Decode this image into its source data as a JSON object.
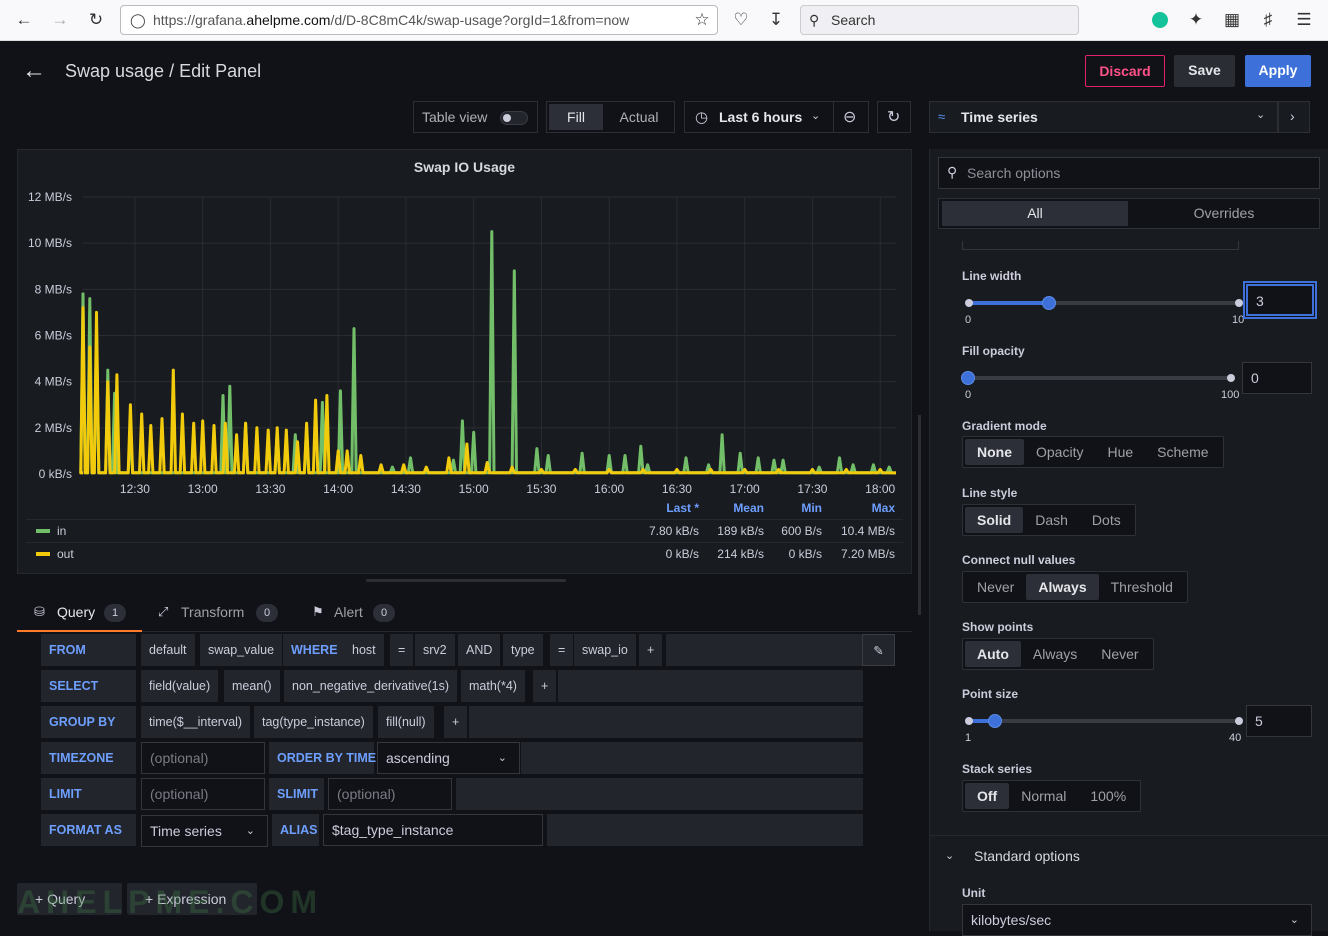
{
  "browser": {
    "url_pre": "https://grafana.",
    "url_domain": "ahelpme.com",
    "url_post": "/d/D-8C8mC4k/swap-usage?orgId=1&from=now",
    "search_placeholder": "Search"
  },
  "header": {
    "title": "Swap usage / Edit Panel",
    "discard": "Discard",
    "save": "Save",
    "apply": "Apply"
  },
  "toolbar": {
    "table_view": "Table view",
    "fill": "Fill",
    "actual": "Actual",
    "time_range": "Last 6 hours",
    "viz": "Time series"
  },
  "chart_data": {
    "type": "line",
    "title": "Swap IO Usage",
    "y_ticks": [
      "12 MB/s",
      "10 MB/s",
      "8 MB/s",
      "6 MB/s",
      "4 MB/s",
      "2 MB/s",
      "0 kB/s"
    ],
    "ylim": [
      0,
      12
    ],
    "yunit": "MB/s",
    "x_ticks": [
      "12:30",
      "13:00",
      "13:30",
      "14:00",
      "14:30",
      "15:00",
      "15:30",
      "16:00",
      "16:30",
      "17:00",
      "17:30",
      "18:00"
    ],
    "xlim": [
      "12:07",
      "18:07"
    ],
    "colors": {
      "in": "#73bf69",
      "out": "#f2cc0c"
    },
    "series": [
      {
        "name": "in",
        "peaks": [
          [
            "12:07",
            7.8
          ],
          [
            "12:10",
            7.6
          ],
          [
            "12:13",
            6.0
          ],
          [
            "12:18",
            4.5
          ],
          [
            "12:21",
            3.5
          ],
          [
            "12:28",
            2.0
          ],
          [
            "13:09",
            3.4
          ],
          [
            "13:12",
            3.8
          ],
          [
            "13:19",
            2.2
          ],
          [
            "13:33",
            1.8
          ],
          [
            "13:41",
            1.7
          ],
          [
            "13:46",
            2.0
          ],
          [
            "13:53",
            3.1
          ],
          [
            "14:01",
            3.6
          ],
          [
            "14:07",
            6.3
          ],
          [
            "14:24",
            0.3
          ],
          [
            "14:32",
            0.7
          ],
          [
            "14:51",
            0.6
          ],
          [
            "14:55",
            2.3
          ],
          [
            "15:00",
            1.8
          ],
          [
            "15:08",
            10.5
          ],
          [
            "15:18",
            8.8
          ],
          [
            "15:28",
            1.1
          ],
          [
            "15:33",
            0.8
          ],
          [
            "15:48",
            0.9
          ],
          [
            "16:00",
            0.8
          ],
          [
            "16:07",
            0.8
          ],
          [
            "16:14",
            1.2
          ],
          [
            "16:17",
            0.4
          ],
          [
            "16:34",
            0.7
          ],
          [
            "16:44",
            0.4
          ],
          [
            "16:50",
            1.7
          ],
          [
            "16:58",
            0.9
          ],
          [
            "17:06",
            0.7
          ],
          [
            "17:13",
            0.6
          ],
          [
            "17:17",
            0.6
          ],
          [
            "17:33",
            0.3
          ],
          [
            "17:42",
            0.7
          ],
          [
            "17:48",
            0.4
          ],
          [
            "17:57",
            0.4
          ],
          [
            "18:04",
            0.3
          ]
        ]
      },
      {
        "name": "out",
        "peaks": [
          [
            "12:07",
            7.2
          ],
          [
            "12:10",
            5.5
          ],
          [
            "12:13",
            7.0
          ],
          [
            "12:18",
            4.0
          ],
          [
            "12:22",
            4.3
          ],
          [
            "12:28",
            3.0
          ],
          [
            "12:33",
            2.6
          ],
          [
            "12:37",
            2.1
          ],
          [
            "12:42",
            2.4
          ],
          [
            "12:47",
            4.5
          ],
          [
            "12:51",
            2.6
          ],
          [
            "12:56",
            2.2
          ],
          [
            "13:00",
            2.3
          ],
          [
            "13:05",
            2.1
          ],
          [
            "13:10",
            2.2
          ],
          [
            "13:15",
            1.7
          ],
          [
            "13:19",
            2.2
          ],
          [
            "13:24",
            2.0
          ],
          [
            "13:29",
            1.9
          ],
          [
            "13:33",
            2.0
          ],
          [
            "13:37",
            1.9
          ],
          [
            "13:42",
            1.4
          ],
          [
            "13:46",
            2.2
          ],
          [
            "13:50",
            3.2
          ],
          [
            "13:55",
            3.4
          ],
          [
            "14:00",
            1.0
          ],
          [
            "14:04",
            1.0
          ],
          [
            "14:10",
            0.8
          ],
          [
            "14:19",
            0.4
          ],
          [
            "14:29",
            0.4
          ],
          [
            "14:39",
            0.3
          ],
          [
            "14:49",
            0.7
          ],
          [
            "14:57",
            1.3
          ],
          [
            "15:06",
            0.5
          ],
          [
            "15:17",
            0.3
          ],
          [
            "15:30",
            0.2
          ],
          [
            "15:45",
            0.2
          ],
          [
            "16:00",
            0.2
          ],
          [
            "16:15",
            0.2
          ],
          [
            "16:30",
            0.2
          ],
          [
            "16:45",
            0.2
          ],
          [
            "17:00",
            0.2
          ],
          [
            "17:15",
            0.2
          ],
          [
            "17:30",
            0.2
          ],
          [
            "17:45",
            0.2
          ],
          [
            "18:00",
            0.2
          ]
        ]
      }
    ],
    "legend": {
      "headers": [
        "Last *",
        "Mean",
        "Min",
        "Max"
      ],
      "rows": [
        {
          "name": "in",
          "values": [
            "7.80 kB/s",
            "189 kB/s",
            "600 B/s",
            "10.4 MB/s"
          ]
        },
        {
          "name": "out",
          "values": [
            "0 kB/s",
            "214 kB/s",
            "0 kB/s",
            "7.20 MB/s"
          ]
        }
      ]
    }
  },
  "tabs": {
    "query": "Query",
    "query_count": "1",
    "transform": "Transform",
    "transform_count": "0",
    "alert": "Alert",
    "alert_count": "0"
  },
  "query": {
    "from": "FROM",
    "from_db": "default",
    "from_meas": "swap_value",
    "where": "WHERE",
    "host_key": "host",
    "eq": "=",
    "host_val": "srv2",
    "and": "AND",
    "type_key": "type",
    "type_val": "swap_io",
    "plus": "+",
    "select": "SELECT",
    "sel1": "field(value)",
    "sel2": "mean()",
    "sel3": "non_negative_derivative(1s)",
    "sel4": "math(*4)",
    "group_by": "GROUP BY",
    "gb1": "time($__interval)",
    "gb2": "tag(type_instance)",
    "gb3": "fill(null)",
    "timezone": "TIMEZONE",
    "optional": "(optional)",
    "order_by": "ORDER BY TIME",
    "order_val": "ascending",
    "limit": "LIMIT",
    "slimit": "SLIMIT",
    "format_as": "FORMAT AS",
    "format_val": "Time series",
    "alias": "ALIAS",
    "alias_val": "$tag_type_instance",
    "add_query": "Query",
    "add_expression": "Expression"
  },
  "watermark": "AHELPME.COM",
  "options": {
    "search_placeholder": "Search options",
    "all": "All",
    "overrides": "Overrides",
    "line_width": "Line width",
    "lw_min": "0",
    "lw_max": "10",
    "lw_value": "3",
    "lw_fraction": 0.3,
    "fill_opacity": "Fill opacity",
    "fo_min": "0",
    "fo_max": "100",
    "fo_value": "0",
    "fo_fraction": 0,
    "gradient_mode": "Gradient mode",
    "gm": [
      "None",
      "Opacity",
      "Hue",
      "Scheme"
    ],
    "line_style": "Line style",
    "ls": [
      "Solid",
      "Dash",
      "Dots"
    ],
    "connect_null": "Connect null values",
    "cn": [
      "Never",
      "Always",
      "Threshold"
    ],
    "show_points": "Show points",
    "sp": [
      "Auto",
      "Always",
      "Never"
    ],
    "point_size": "Point size",
    "ps_min": "1",
    "ps_max": "40",
    "ps_value": "5",
    "ps_fraction": 0.1,
    "stack_series": "Stack series",
    "ss": [
      "Off",
      "Normal",
      "100%"
    ],
    "standard_options": "Standard options",
    "unit": "Unit",
    "unit_value": "kilobytes/sec"
  }
}
